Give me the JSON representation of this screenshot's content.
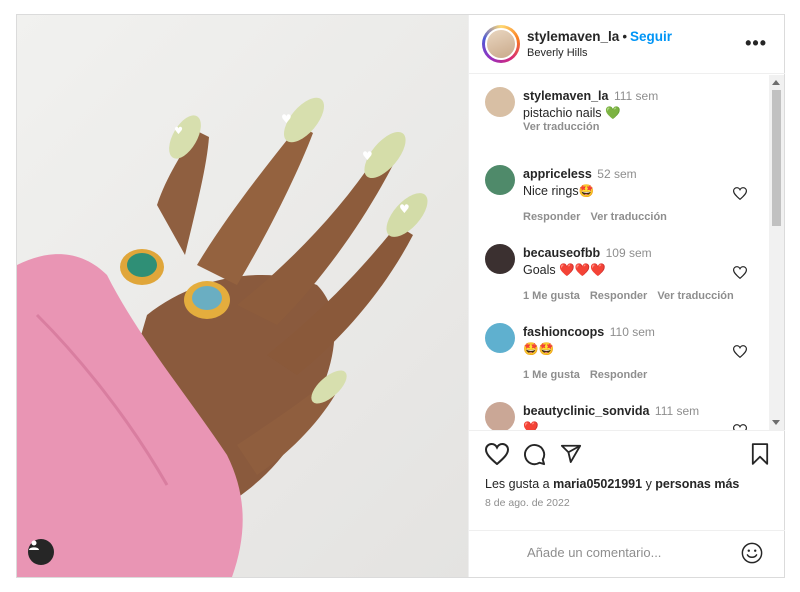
{
  "header": {
    "username": "stylemaven_la",
    "separator": "•",
    "follow": "Seguir",
    "location": "Beverly Hills",
    "more": "•••"
  },
  "comments": [
    {
      "user": "stylemaven_la",
      "time": "111 sem",
      "text": "pistachio nails 💚",
      "actions": [
        "Ver traducción"
      ],
      "avatar_color": "#d8bfa4",
      "liked": false
    },
    {
      "user": "appriceless",
      "time": "52 sem",
      "text": "Nice rings🤩",
      "actions": [
        "Responder",
        "Ver traducción"
      ],
      "avatar_color": "#4f8a6a",
      "liked": false
    },
    {
      "user": "becauseofbb",
      "time": "109 sem",
      "text": "Goals ❤️❤️❤️",
      "actions": [
        "1 Me gusta",
        "Responder",
        "Ver traducción"
      ],
      "avatar_color": "#3b3030",
      "liked": false
    },
    {
      "user": "fashioncoops",
      "time": "110 sem",
      "text": "🤩🤩",
      "actions": [
        "1 Me gusta",
        "Responder"
      ],
      "avatar_color": "#5fb0cf",
      "liked": false
    },
    {
      "user": "beautyclinic_sonvida",
      "time": "111 sem",
      "text": "❤️",
      "actions": [],
      "avatar_color": "#caa796",
      "liked": false
    }
  ],
  "footer": {
    "likes_prefix": "Les gusta a ",
    "likes_user": "maria05021991",
    "likes_mid": " y ",
    "likes_others": "personas más",
    "date": "8 de ago. de 2022"
  },
  "add_comment": {
    "placeholder": "Añade un comentario..."
  },
  "icons": [
    "like-icon",
    "comment-icon",
    "share-icon",
    "save-icon",
    "emoji-icon",
    "user-tag-icon",
    "comment-like-icon"
  ],
  "colors": {
    "follow": "#0095f6",
    "text": "#262626",
    "muted": "#8e8e8e",
    "border": "#dbdbdb",
    "jacket": "#e995b4",
    "nails": "#d7dfae"
  }
}
